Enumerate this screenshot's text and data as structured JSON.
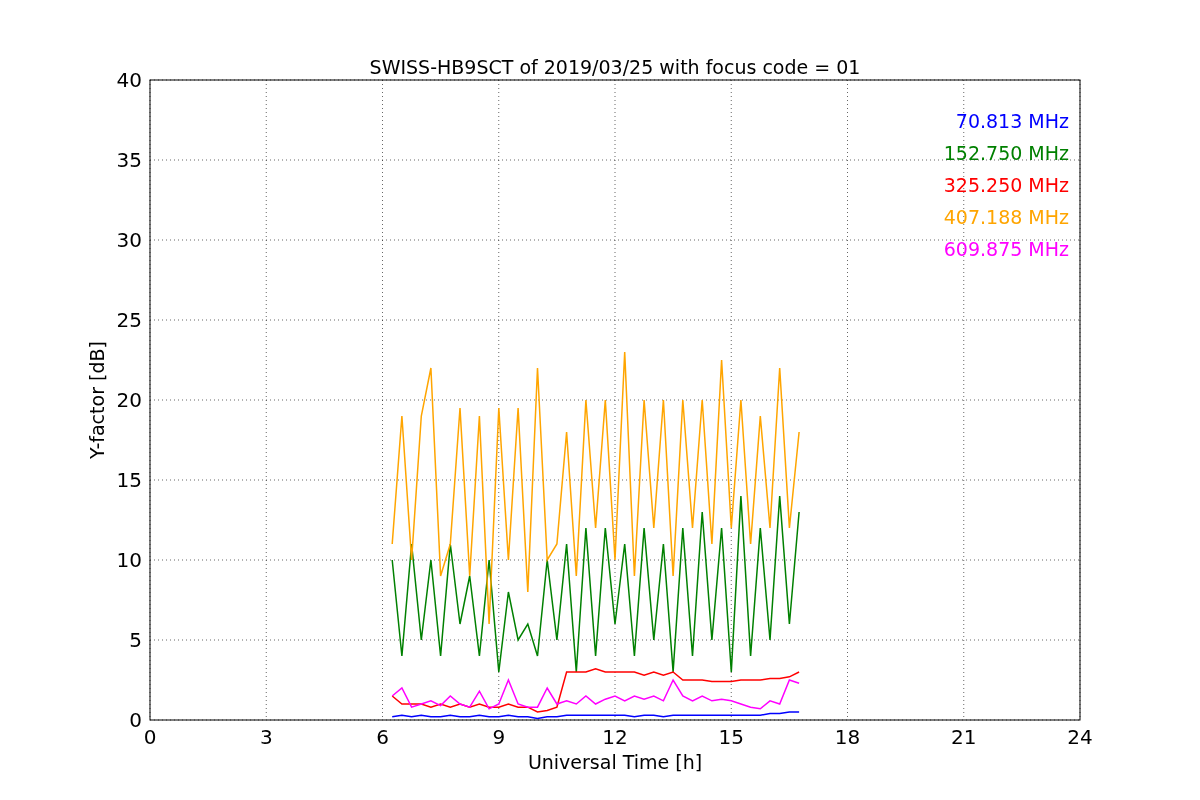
{
  "figure": {
    "chart_data": {
      "type": "line",
      "title": "SWISS-HB9SCT of 2019/03/25 with focus code = 01",
      "xlabel": "Universal Time [h]",
      "ylabel": "Y-factor [dB]",
      "x": [
        6.25,
        6.5,
        6.75,
        7,
        7.25,
        7.5,
        7.75,
        8,
        8.25,
        8.5,
        8.75,
        9,
        9.25,
        9.5,
        9.75,
        10,
        10.25,
        10.5,
        10.75,
        11,
        11.25,
        11.5,
        11.75,
        12,
        12.25,
        12.5,
        12.75,
        13,
        13.25,
        13.5,
        13.75,
        14,
        14.25,
        14.5,
        14.75,
        15,
        15.25,
        15.5,
        15.75,
        16,
        16.25,
        16.5,
        16.75
      ],
      "series": [
        {
          "name": "70.813 MHz",
          "color": "#0000ff",
          "values": [
            0.2,
            0.3,
            0.2,
            0.3,
            0.2,
            0.2,
            0.3,
            0.2,
            0.2,
            0.3,
            0.2,
            0.2,
            0.3,
            0.2,
            0.2,
            0.1,
            0.2,
            0.2,
            0.3,
            0.3,
            0.3,
            0.3,
            0.3,
            0.3,
            0.3,
            0.2,
            0.3,
            0.3,
            0.2,
            0.3,
            0.3,
            0.3,
            0.3,
            0.3,
            0.3,
            0.3,
            0.3,
            0.3,
            0.3,
            0.4,
            0.4,
            0.5,
            0.5
          ]
        },
        {
          "name": "152.750 MHz",
          "color": "#008000",
          "values": [
            10,
            4,
            11,
            5,
            10,
            4,
            11,
            6,
            9,
            4,
            10,
            3,
            8,
            5,
            6,
            4,
            10,
            5,
            11,
            3,
            12,
            4,
            12,
            6,
            11,
            4,
            12,
            5,
            11,
            3,
            12,
            4,
            13,
            5,
            12,
            3,
            14,
            4,
            12,
            5,
            14,
            6,
            13
          ]
        },
        {
          "name": "325.250 MHz",
          "color": "#ff0000",
          "values": [
            1.5,
            1,
            1,
            1,
            0.8,
            1,
            0.8,
            1,
            0.8,
            1,
            0.8,
            0.8,
            1,
            0.8,
            0.8,
            0.5,
            0.6,
            0.8,
            3,
            3,
            3,
            3.2,
            3,
            3,
            3,
            3,
            2.8,
            3,
            2.8,
            3,
            2.5,
            2.5,
            2.5,
            2.4,
            2.4,
            2.4,
            2.5,
            2.5,
            2.5,
            2.6,
            2.6,
            2.7,
            3
          ]
        },
        {
          "name": "407.188 MHz",
          "color": "#ffa500",
          "values": [
            11,
            19,
            10,
            19,
            22,
            9,
            11,
            19.5,
            9,
            19,
            6,
            19.5,
            10,
            19.5,
            8,
            22,
            10,
            11,
            18,
            9,
            20,
            12,
            20,
            10,
            23,
            9,
            20,
            12,
            20,
            9,
            20,
            12,
            20,
            11,
            22.5,
            12,
            20,
            11,
            19,
            12,
            22,
            12,
            18
          ]
        },
        {
          "name": "609.875 MHz",
          "color": "#ff00ff",
          "values": [
            1.5,
            2,
            0.8,
            1,
            1.2,
            0.9,
            1.5,
            1,
            0.8,
            1.8,
            0.7,
            1,
            2.5,
            1,
            0.8,
            0.8,
            2,
            1,
            1.2,
            1,
            1.5,
            1,
            1.3,
            1.5,
            1.2,
            1.5,
            1.3,
            1.5,
            1.2,
            2.5,
            1.5,
            1.2,
            1.5,
            1.2,
            1.3,
            1.2,
            1,
            0.8,
            0.7,
            1.2,
            1,
            2.5,
            2.3
          ]
        }
      ],
      "xlim": [
        0,
        24
      ],
      "ylim": [
        0,
        40
      ],
      "xticks": [
        0,
        3,
        6,
        9,
        12,
        15,
        18,
        21,
        24
      ],
      "yticks": [
        0,
        5,
        10,
        15,
        20,
        25,
        30,
        35,
        40
      ],
      "grid": true
    }
  }
}
